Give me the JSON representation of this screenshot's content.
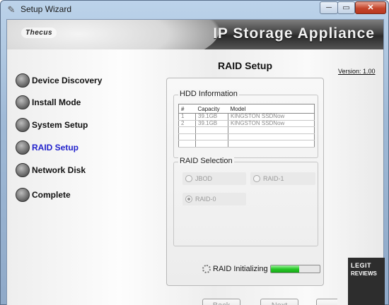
{
  "window": {
    "title": "Setup Wizard",
    "icon": "wizard-app-icon",
    "min_glyph": "─",
    "max_glyph": "▭",
    "close_glyph": "✕"
  },
  "banner": {
    "logo": "Thecus",
    "title": "IP Storage Appliance"
  },
  "nav": {
    "items": [
      {
        "label": "Device Discovery",
        "active": false
      },
      {
        "label": "Install Mode",
        "active": false
      },
      {
        "label": "System Setup",
        "active": false
      },
      {
        "label": "RAID Setup",
        "active": true
      },
      {
        "label": "Network Disk",
        "active": false
      },
      {
        "label": "Complete",
        "active": false
      }
    ]
  },
  "page": {
    "title": "RAID Setup",
    "version": "Version: 1.00"
  },
  "hdd": {
    "group_title": "HDD Information",
    "columns": [
      "#",
      "Capacity",
      "Model"
    ],
    "rows": [
      [
        "1",
        "39.1GB",
        "KINGSTON SSDNow"
      ],
      [
        "2",
        "39.1GB",
        "KINGSTON SSDNow"
      ],
      [
        "",
        "",
        ""
      ],
      [
        "",
        "",
        ""
      ],
      [
        "",
        "",
        ""
      ]
    ]
  },
  "raid": {
    "group_title": "RAID Selection",
    "options": {
      "jbod": "JBOD",
      "raid1": "RAID-1",
      "raid0": "RAID-0"
    },
    "selected": "RAID-0"
  },
  "status": {
    "label": "RAID Initializing",
    "progress": 0.58
  },
  "buttons": {
    "back": "Back",
    "next": "Next",
    "finish": ""
  },
  "watermark": {
    "line1": "LEGIT",
    "line2": "REVIEWS"
  },
  "colors": {
    "active_nav": "#2222cc",
    "progress": "#28c828"
  }
}
